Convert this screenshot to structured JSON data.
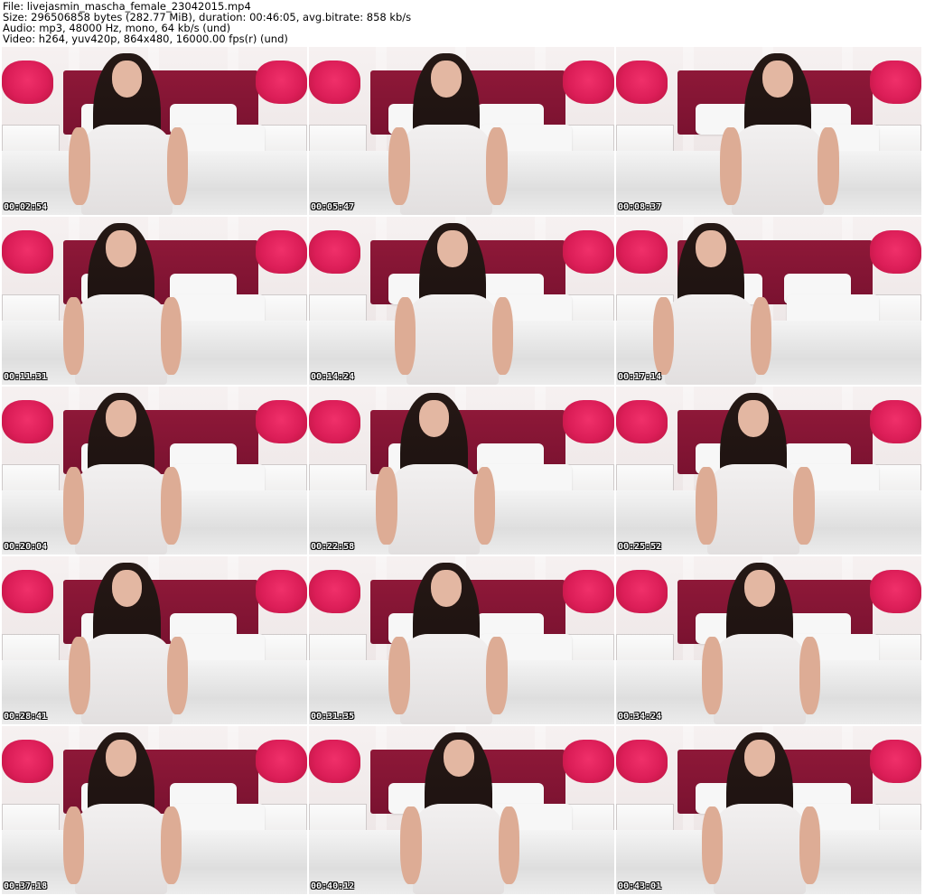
{
  "header": {
    "file": "File: livejasmin_mascha_female_23042015.mp4",
    "size": "Size: 296506858 bytes (282.77 MiB), duration: 00:46:05, avg.bitrate: 858 kb/s",
    "audio": "Audio: mp3, 48000 Hz, mono, 64 kb/s (und)",
    "video": "Video: h264, yuv420p, 864x480, 16000.00 fps(r) (und)"
  },
  "thumbnails": [
    {
      "timestamp": "00:02:54"
    },
    {
      "timestamp": "00:05:47"
    },
    {
      "timestamp": "00:08:37"
    },
    {
      "timestamp": "00:11:31"
    },
    {
      "timestamp": "00:14:24"
    },
    {
      "timestamp": "00:17:14"
    },
    {
      "timestamp": "00:20:04"
    },
    {
      "timestamp": "00:22:58"
    },
    {
      "timestamp": "00:25:52"
    },
    {
      "timestamp": "00:28:41"
    },
    {
      "timestamp": "00:31:35"
    },
    {
      "timestamp": "00:34:24"
    },
    {
      "timestamp": "00:37:18"
    },
    {
      "timestamp": "00:40:12"
    },
    {
      "timestamp": "00:43:01"
    }
  ],
  "colors": {
    "headboard": "#7a1230",
    "flowers": "#dc1e58",
    "timestamp_text": "#ffffff",
    "timestamp_outline": "#000000"
  }
}
